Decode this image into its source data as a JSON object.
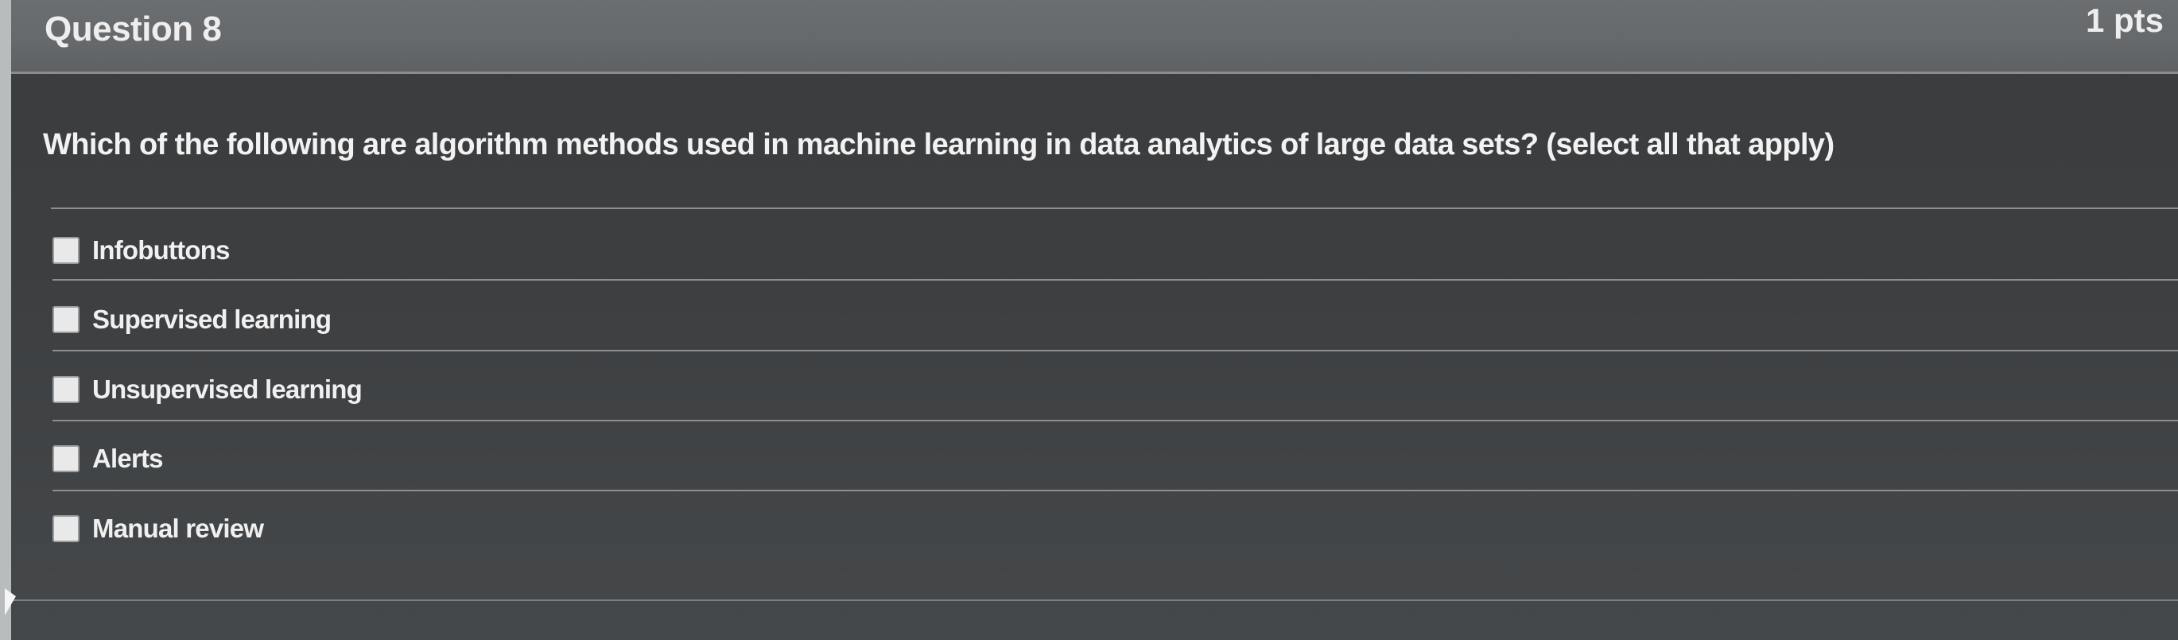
{
  "question": {
    "title": "Question 8",
    "points": "1 pts",
    "prompt": "Which of the following are algorithm methods used in machine learning in data analytics of large data sets? (select all that apply)"
  },
  "answers": [
    {
      "label": "Infobuttons",
      "checked": false
    },
    {
      "label": "Supervised learning",
      "checked": false
    },
    {
      "label": "Unsupervised learning",
      "checked": false
    },
    {
      "label": "Alerts",
      "checked": false
    },
    {
      "label": "Manual review",
      "checked": false
    }
  ]
}
